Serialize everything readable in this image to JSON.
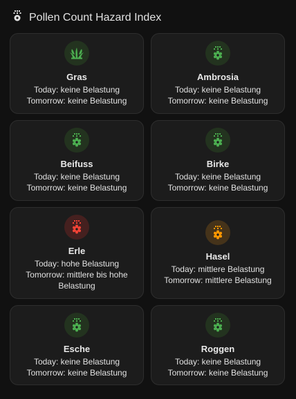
{
  "header": {
    "title": "Pollen Count Hazard Index",
    "icon": "flower-pollen-icon"
  },
  "colors": {
    "green": "#4caf50",
    "green_bg": "#23331f",
    "red": "#f44336",
    "red_bg": "#45201f",
    "orange": "#ff9800",
    "orange_bg": "#45331a"
  },
  "cards": [
    {
      "name": "Gras",
      "today": "Today: keine Belastung",
      "tomorrow": "Tomorrow: keine Belastung",
      "icon": "grass-icon",
      "level": "green"
    },
    {
      "name": "Ambrosia",
      "today": "Today: keine Belastung",
      "tomorrow": "Tomorrow: keine Belastung",
      "icon": "flower-pollen-icon",
      "level": "green"
    },
    {
      "name": "Beifuss",
      "today": "Today: keine Belastung",
      "tomorrow": "Tomorrow: keine Belastung",
      "icon": "flower-pollen-icon",
      "level": "green"
    },
    {
      "name": "Birke",
      "today": "Today: keine Belastung",
      "tomorrow": "Tomorrow: keine Belastung",
      "icon": "flower-pollen-icon",
      "level": "green"
    },
    {
      "name": "Erle",
      "today": "Today: hohe Belastung",
      "tomorrow": "Tomorrow: mittlere bis hohe Belastung",
      "icon": "flower-pollen-icon",
      "level": "red"
    },
    {
      "name": "Hasel",
      "today": "Today: mittlere Belastung",
      "tomorrow": "Tomorrow: mittlere Belastung",
      "icon": "flower-pollen-icon",
      "level": "orange"
    },
    {
      "name": "Esche",
      "today": "Today: keine Belastung",
      "tomorrow": "Tomorrow: keine Belastung",
      "icon": "flower-pollen-icon",
      "level": "green"
    },
    {
      "name": "Roggen",
      "today": "Today: keine Belastung",
      "tomorrow": "Tomorrow: keine Belastung",
      "icon": "flower-pollen-icon",
      "level": "green"
    }
  ]
}
